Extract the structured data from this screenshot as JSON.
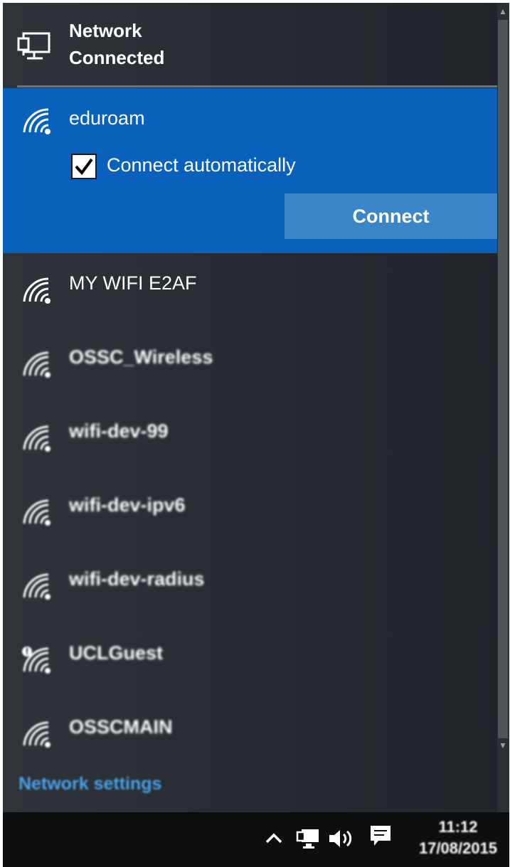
{
  "header": {
    "title": "Network",
    "status": "Connected",
    "icon": "ethernet-icon"
  },
  "selected_network": {
    "name": "eduroam",
    "icon": "wifi-signal-icon",
    "auto_connect_label": "Connect automatically",
    "auto_connect_checked": true,
    "connect_button_label": "Connect"
  },
  "networks": [
    {
      "name": "MY WIFI E2AF",
      "icon": "wifi-signal-icon",
      "blurred": false
    },
    {
      "name": "OSSC_Wireless",
      "icon": "wifi-signal-icon",
      "blurred": true
    },
    {
      "name": "wifi-dev-99",
      "icon": "wifi-signal-icon",
      "blurred": true
    },
    {
      "name": "wifi-dev-ipv6",
      "icon": "wifi-signal-icon",
      "blurred": true
    },
    {
      "name": "wifi-dev-radius",
      "icon": "wifi-signal-icon",
      "blurred": true
    },
    {
      "name": "UCLGuest",
      "icon": "wifi-signal-warning-icon",
      "blurred": true
    },
    {
      "name": "OSSCMAIN",
      "icon": "wifi-signal-icon",
      "blurred": true
    }
  ],
  "footer": {
    "settings_link": "Network settings"
  },
  "taskbar": {
    "time": "11:12",
    "date": "17/08/2015",
    "icons": [
      "chevron-up-icon",
      "network-icon",
      "volume-icon",
      "notification-icon"
    ]
  },
  "colors": {
    "selected_bg": "#0a61bb",
    "connect_button_bg": "#3a86c9",
    "link": "#4aa2ea",
    "flyout_bg": "#262c32",
    "taskbar_bg": "#0c0e10"
  }
}
